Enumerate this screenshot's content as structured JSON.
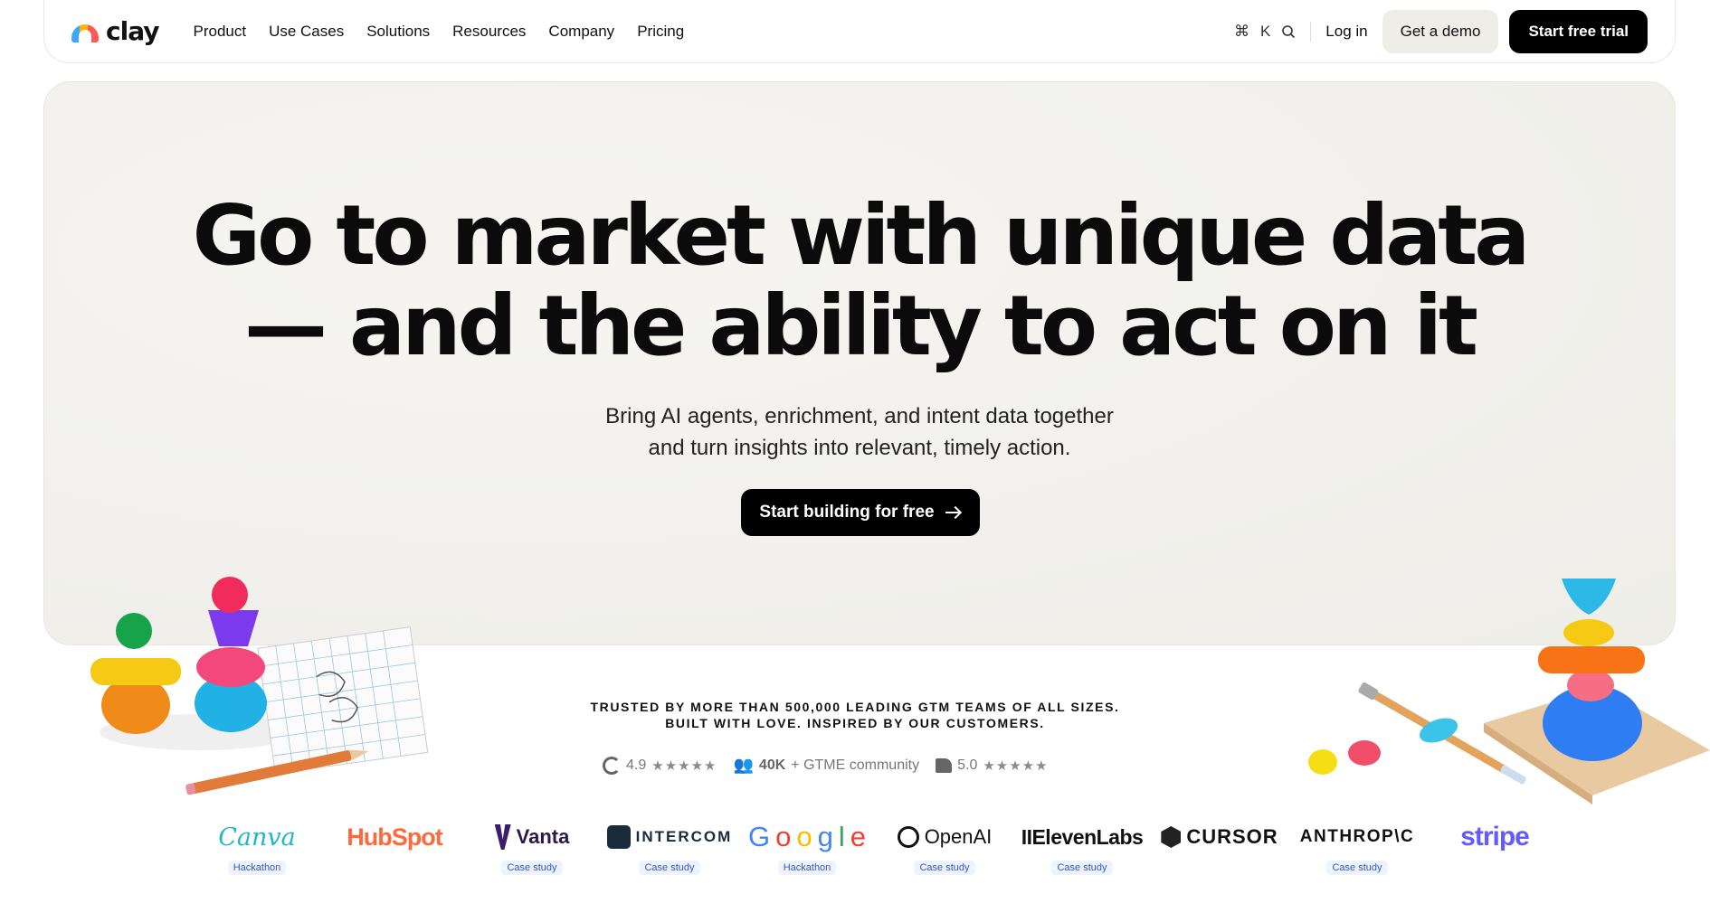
{
  "nav": {
    "brand": "clay",
    "links": [
      "Product",
      "Use Cases",
      "Solutions",
      "Resources",
      "Company",
      "Pricing"
    ],
    "shortcut_symbol": "⌘",
    "shortcut_key": "K",
    "search_icon": "search-icon",
    "login": "Log in",
    "demo": "Get a demo",
    "trial": "Start free trial"
  },
  "hero": {
    "title_line1": "Go to market with unique data",
    "title_line2": "— and the ability to act on it",
    "sub_line1": "Bring AI agents, enrichment, and intent data together",
    "sub_line2": "and turn insights into relevant, timely action.",
    "cta": "Start building for free"
  },
  "trust": {
    "line1": "TRUSTED BY MORE THAN 500,000 LEADING GTM TEAMS OF ALL SIZES.",
    "line2": "BUILT WITH LOVE. INSPIRED BY OUR CUSTOMERS.",
    "g2_score": "4.9",
    "community_count": "40K",
    "community_label": "+ GTME community",
    "capterra_score": "5.0",
    "stars": "★★★★★"
  },
  "logos": [
    {
      "name": "Canva",
      "tag": "Hackathon"
    },
    {
      "name": "HubSpot",
      "tag": ""
    },
    {
      "name": "Vanta",
      "tag": "Case study"
    },
    {
      "name": "INTERCOM",
      "tag": "Case study"
    },
    {
      "name": "Google",
      "tag": "Hackathon"
    },
    {
      "name": "OpenAI",
      "tag": "Case study"
    },
    {
      "name": "IIElevenLabs",
      "tag": "Case study"
    },
    {
      "name": "CURSOR",
      "tag": ""
    },
    {
      "name": "ANTHROP\\C",
      "tag": "Case study"
    },
    {
      "name": "stripe",
      "tag": ""
    }
  ],
  "colors": {
    "hero_bg": "#f1f0ec",
    "button_dark": "#000000",
    "tag_blue": "#3257d0",
    "stripe": "#635bff"
  }
}
